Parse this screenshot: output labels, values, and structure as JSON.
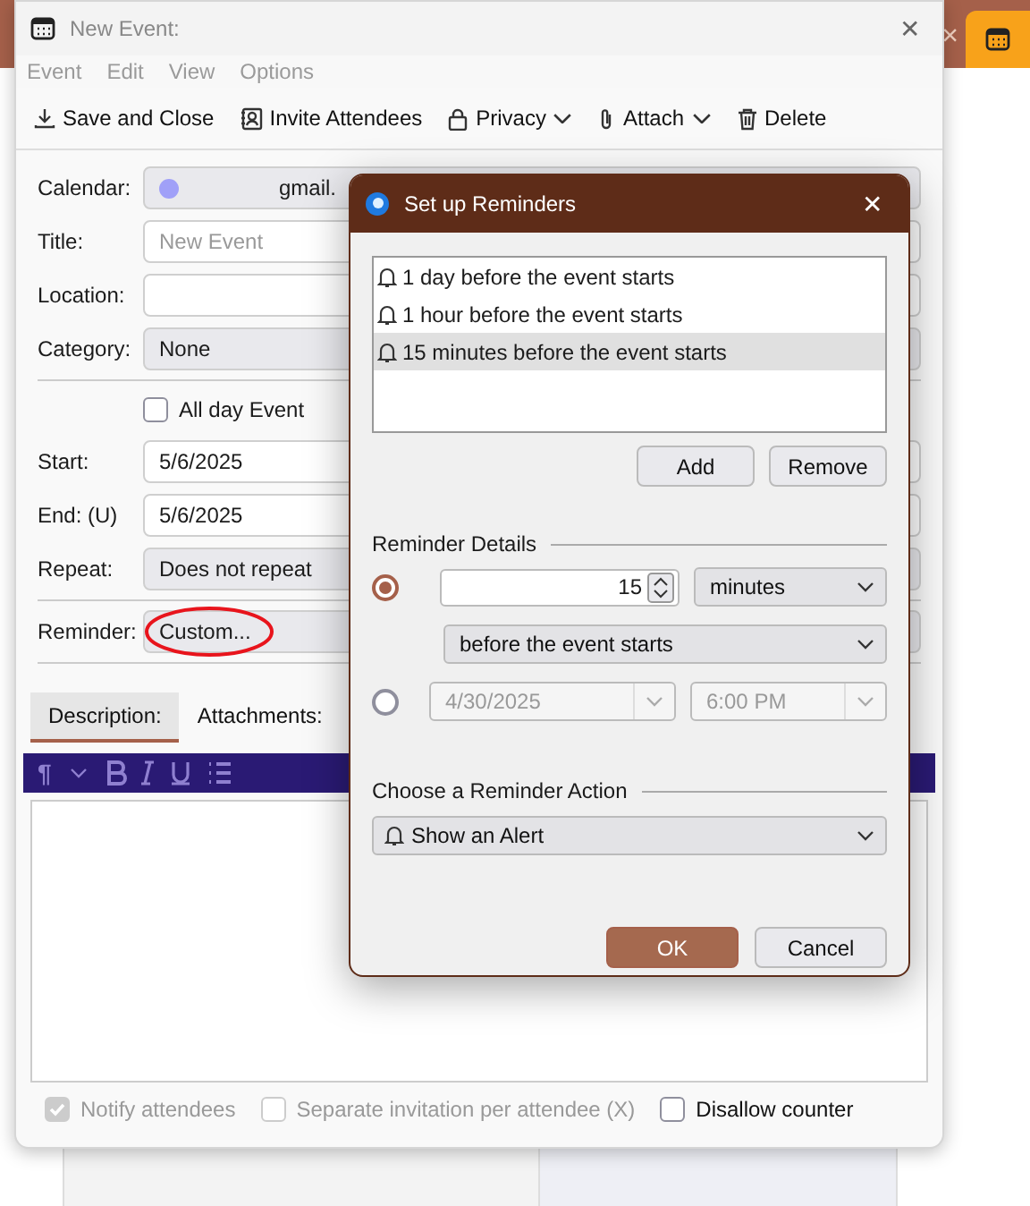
{
  "background_app": {
    "tab_close": "×"
  },
  "window": {
    "title": "New Event:",
    "close": "✕"
  },
  "menu": [
    "Event",
    "Edit",
    "View",
    "Options"
  ],
  "toolbar": [
    {
      "label": "Save and Close",
      "kind": "save",
      "dropdown": false
    },
    {
      "label": "Invite Attendees",
      "kind": "invite",
      "dropdown": false
    },
    {
      "label": "Privacy",
      "kind": "privacy",
      "dropdown": true
    },
    {
      "label": "Attach",
      "kind": "attach",
      "dropdown": true
    },
    {
      "label": "Delete",
      "kind": "delete",
      "dropdown": false
    }
  ],
  "form": [
    {
      "label": "Calendar:",
      "kind": "calendar",
      "value": "gmail.",
      "color": "#a0a0f8"
    },
    {
      "label": "Title:",
      "kind": "input",
      "placeholder": "New Event"
    },
    {
      "label": "Location:",
      "kind": "input"
    },
    {
      "label": "Category:",
      "kind": "select",
      "value": "None"
    },
    {
      "kind": "divider"
    },
    {
      "kind": "checkbox",
      "label": "All day Event",
      "checked": false
    },
    {
      "label": "Start:",
      "kind": "input",
      "value": "5/6/2025"
    },
    {
      "label": "End: (U)",
      "kind": "input",
      "value": "5/6/2025"
    },
    {
      "label": "Repeat:",
      "kind": "select",
      "value": "Does not repeat"
    },
    {
      "kind": "divider"
    },
    {
      "label": "Reminder:",
      "kind": "select",
      "value": "Custom...",
      "annotated": true
    },
    {
      "kind": "divider"
    }
  ],
  "tabs": [
    {
      "label": "Description:",
      "selected": true
    },
    {
      "label": "Attachments:",
      "selected": false
    }
  ],
  "format_bar": {
    "paragraph": "¶"
  },
  "footer": [
    {
      "label": "Notify attendees",
      "checked": true,
      "disabled": true
    },
    {
      "label": "Separate invitation per attendee (X)",
      "checked": false,
      "disabled": true
    },
    {
      "label": "Disallow counter",
      "checked": false,
      "disabled": false
    }
  ],
  "dialog": {
    "title": "Set up Reminders",
    "close": "✕",
    "reminders": [
      {
        "label": "1 day before the event starts",
        "selected": false
      },
      {
        "label": "1 hour before the event starts",
        "selected": false
      },
      {
        "label": "15 minutes before the event starts",
        "selected": true
      }
    ],
    "buttons": [
      "Add",
      "Remove"
    ],
    "details_title": "Reminder Details",
    "relative": {
      "selected": true,
      "amount": "15",
      "unit": "minutes",
      "relation": "before the event starts"
    },
    "absolute": {
      "selected": false,
      "date": "4/30/2025",
      "time": "6:00 PM"
    },
    "action_title": "Choose a Reminder Action",
    "action": "Show an Alert",
    "ok": "OK",
    "cancel": "Cancel"
  }
}
